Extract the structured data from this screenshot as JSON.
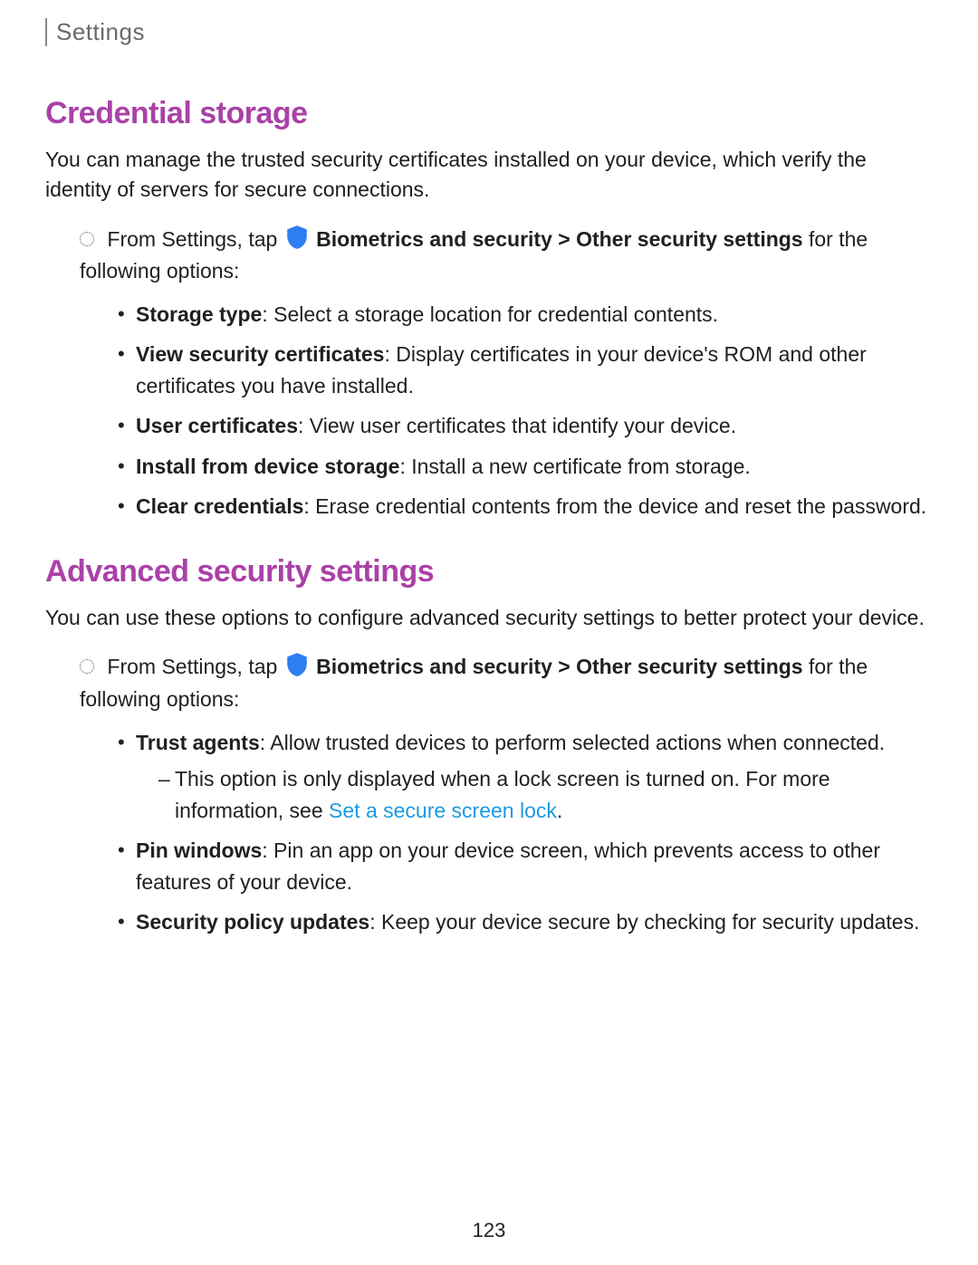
{
  "breadcrumb": "Settings",
  "section1": {
    "title": "Credential storage",
    "intro": "You can manage the trusted security certificates installed on your device, which verify the identity of servers for secure connections.",
    "step_prefix": "From Settings, tap",
    "step_link1": "Biometrics and security",
    "step_sep": " > ",
    "step_link2": "Other security settings",
    "step_suffix": " for the following options:",
    "options": [
      {
        "label": "Storage type",
        "desc": ": Select a storage location for credential contents."
      },
      {
        "label": "View security certificates",
        "desc": ": Display certificates in your device's ROM and other certificates you have installed."
      },
      {
        "label": "User certificates",
        "desc": ": View user certificates that identify your device."
      },
      {
        "label": "Install from device storage",
        "desc": ": Install a new certificate from storage."
      },
      {
        "label": "Clear credentials",
        "desc": ": Erase credential contents from the device and reset the password."
      }
    ]
  },
  "section2": {
    "title": "Advanced security settings",
    "intro": "You can use these options to configure advanced security settings to better protect your device.",
    "step_prefix": "From Settings, tap",
    "step_link1": "Biometrics and security",
    "step_sep": " > ",
    "step_link2": "Other security settings",
    "step_suffix": " for the following options:",
    "options": [
      {
        "label": "Trust agents",
        "desc": ": Allow trusted devices to perform selected actions when connected.",
        "sub_pre": "This option is only displayed when a lock screen is turned on. For more information, see ",
        "sub_link": "Set a secure screen lock",
        "sub_post": "."
      },
      {
        "label": "Pin windows",
        "desc": ": Pin an app on your device screen, which prevents access to other features of your device."
      },
      {
        "label": "Security policy updates",
        "desc": ": Keep your device secure by checking for security updates."
      }
    ]
  },
  "page_number": "123"
}
